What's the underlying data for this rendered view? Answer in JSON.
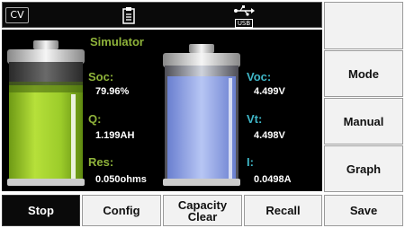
{
  "status_bar": {
    "mode": "CV",
    "clipboard_icon": "clipboard-icon",
    "usb_icon": "usb-icon",
    "usb_label": "USB"
  },
  "main": {
    "title": "Simulator",
    "soc_label": "Soc:",
    "soc_value": "79.96%",
    "soc_level": 0.7996,
    "q_label": "Q:",
    "q_value": "1.199AH",
    "res_label": "Res:",
    "res_value": "0.050ohms",
    "voc_label": "Voc:",
    "voc_value": "4.499V",
    "vt_label": "Vt:",
    "vt_value": "4.498V",
    "i_label": "I:",
    "i_value": "0.0498A"
  },
  "right_buttons": {
    "top": "",
    "mode": "Mode",
    "manual": "Manual",
    "graph": "Graph"
  },
  "bottom_buttons": {
    "stop": "Stop",
    "config": "Config",
    "capacity_line1": "Capacity",
    "capacity_line2": "Clear",
    "recall": "Recall",
    "save": "Save"
  },
  "colors": {
    "green_label": "#8fb33a",
    "cyan_label": "#3fb7c8",
    "battery_green": "#9ccc2a",
    "battery_blue": "#8fa6e6"
  }
}
